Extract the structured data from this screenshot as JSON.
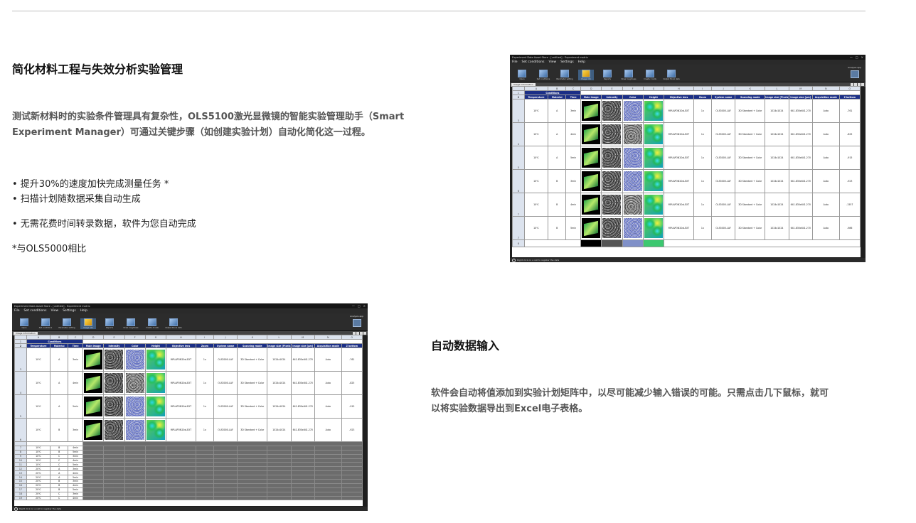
{
  "section1": {
    "title": "简化材料工程与失效分析实验管理",
    "paragraph_line1": "测试新材料时的实验条件管理具有复杂性，OLS5100激光显微镜的智能实验管理助手（Smart",
    "paragraph_line2": "Experiment Manager）可通过关键步骤（如创建实验计划）自动化简化这一过程。",
    "bullets": [
      "• 提升30%的速度加快完成测量任务 *",
      "• 扫描计划随数据采集自动生成",
      "• 无需花费时间转录数据，软件为您自动完成"
    ],
    "footnote": "*与OLS5000相比"
  },
  "section2": {
    "title": "自动数据输入",
    "paragraph_line1": "软件会自动将值添加到实验计划矩阵中，以尽可能减少输入错误的可能。只需点击几下鼠标，就可",
    "paragraph_line2": "以将实验数据导出到Excel电子表格。"
  },
  "app": {
    "title": "Experiment Data Asset Store - [untitled] - Experiment matrix",
    "menu": [
      "File",
      "Set conditions",
      "View",
      "Settings",
      "Help"
    ],
    "window_controls": [
      "—",
      "□",
      "×"
    ],
    "toolbar": [
      {
        "label": "Open",
        "icon": "folder-icon"
      },
      {
        "label": "Set conditions",
        "icon": "conditions-icon"
      },
      {
        "label": "Parameter setting",
        "icon": "parameter-icon"
      },
      {
        "label": "Image info",
        "icon": "image-info-icon"
      },
      {
        "label": "Reports",
        "icon": "reports-icon"
      },
      {
        "label": "Draw roughness",
        "icon": "roughness-icon"
      },
      {
        "label": "Create 2 cells",
        "icon": "cells-icon"
      },
      {
        "label": "Output Excel data",
        "icon": "excel-icon"
      }
    ],
    "active_tool_index": 3,
    "analysis_label": "Analysis app",
    "panel_tab": "Image information",
    "col_letters": [
      "",
      "A",
      "B",
      "C",
      "D",
      "E",
      "F",
      "G",
      "H",
      "I",
      "J",
      "K",
      "L",
      "M",
      "N",
      "O"
    ],
    "conditions_label": "Conditions",
    "headers": [
      "Temperature",
      "Material",
      "Time",
      "Main image",
      "Intensity",
      "Color",
      "Height",
      "Objective lens",
      "Zoom",
      "System name",
      "Scanning mode",
      "Image size [Pixels]",
      "Image size [µm]",
      "Acquisition mode",
      "Z bottom"
    ],
    "status_text": "Right click on a cell to register the data"
  },
  "screenshot_top": {
    "rows": [
      {
        "num": "3",
        "temp": "10℃",
        "material": "A",
        "time": "3min",
        "lens": "MPLAPON20xLEXT",
        "zoom": "1x",
        "system": "OLS5000-LAF",
        "scan": "3D Standard + Color",
        "px": "1024x1024",
        "um": "641.830x641.270",
        "acq": "Auto",
        "zb": "-761"
      },
      {
        "num": "4",
        "temp": "10℃",
        "material": "A",
        "time": "4min",
        "lens": "MPLAPON20xLEXT",
        "zoom": "1x",
        "system": "OLS5000-LAF",
        "scan": "3D Standard + Color",
        "px": "1024x1024",
        "um": "641.830x641.270",
        "acq": "Auto",
        "zb": "-825"
      },
      {
        "num": "5",
        "temp": "10℃",
        "material": "A",
        "time": "5min",
        "lens": "MPLAPON20xLEXT",
        "zoom": "1x",
        "system": "OLS5000-LAF",
        "scan": "3D Standard + Color",
        "px": "1024x1024",
        "um": "641.830x641.270",
        "acq": "Auto",
        "zb": "-915"
      },
      {
        "num": "6",
        "temp": "10℃",
        "material": "B",
        "time": "3min",
        "lens": "MPLAPON20xLEXT",
        "zoom": "1x",
        "system": "OLS5000-LAF",
        "scan": "3D Standard + Color",
        "px": "1024x1024",
        "um": "641.830x641.270",
        "acq": "Auto",
        "zb": "-923"
      },
      {
        "num": "7",
        "temp": "10℃",
        "material": "B",
        "time": "4min",
        "lens": "MPLAPON20xLEXT",
        "zoom": "1x",
        "system": "OLS5000-LAF",
        "scan": "3D Standard + Color",
        "px": "1024x1024",
        "um": "641.830x641.270",
        "acq": "Auto",
        "zb": "-1557"
      },
      {
        "num": "7",
        "temp": "10℃",
        "material": "B",
        "time": "5min",
        "lens": "MPLAPON20xLEXT",
        "zoom": "1x",
        "system": "OLS5000-LAF",
        "scan": "3D Standard + Color",
        "px": "1024x1024",
        "um": "641.830x641.270",
        "acq": "Auto",
        "zb": "-986"
      }
    ],
    "last_row_num": "8"
  },
  "screenshot_bottom": {
    "rows": [
      {
        "num": "3",
        "temp": "10℃",
        "material": "A",
        "time": "3min",
        "lens": "MPLAPON20xLEXT",
        "zoom": "1x",
        "system": "OLS5000-LAF",
        "scan": "3D Standard + Color",
        "px": "1024x1024",
        "um": "641.830x641.270",
        "acq": "Auto",
        "zb": "-761"
      },
      {
        "num": "4",
        "temp": "10℃",
        "material": "A",
        "time": "4min",
        "lens": "MPLAPON20xLEXT",
        "zoom": "1x",
        "system": "OLS5000-LAF",
        "scan": "3D Standard + Color",
        "px": "1024x1024",
        "um": "641.830x641.270",
        "acq": "Auto",
        "zb": "-825"
      },
      {
        "num": "5",
        "temp": "10℃",
        "material": "A",
        "time": "5min",
        "lens": "MPLAPON20xLEXT",
        "zoom": "1x",
        "system": "OLS5000-LAF",
        "scan": "3D Standard + Color",
        "px": "1024x1024",
        "um": "641.830x641.270",
        "acq": "Auto",
        "zb": "-915"
      },
      {
        "num": "6",
        "temp": "10℃",
        "material": "B",
        "time": "3min",
        "lens": "MPLAPON20xLEXT",
        "zoom": "1x",
        "system": "OLS5000-LAF",
        "scan": "3D Standard + Color",
        "px": "1024x1024",
        "um": "641.830x641.270",
        "acq": "Auto",
        "zb": "-923"
      }
    ],
    "small_rows": [
      {
        "num": "7",
        "temp": "10℃",
        "material": "B",
        "time": "4min"
      },
      {
        "num": "8",
        "temp": "10℃",
        "material": "B",
        "time": "5min"
      },
      {
        "num": "9",
        "temp": "10℃",
        "material": "C",
        "time": "3min"
      },
      {
        "num": "10",
        "temp": "10℃",
        "material": "C",
        "time": "4min"
      },
      {
        "num": "11",
        "temp": "10℃",
        "material": "C",
        "time": "5min"
      },
      {
        "num": "12",
        "temp": "20℃",
        "material": "A",
        "time": "3min"
      },
      {
        "num": "13",
        "temp": "20℃",
        "material": "A",
        "time": "4min"
      },
      {
        "num": "14",
        "temp": "20℃",
        "material": "A",
        "time": "5min"
      },
      {
        "num": "15",
        "temp": "20℃",
        "material": "B",
        "time": "3min"
      },
      {
        "num": "16",
        "temp": "20℃",
        "material": "B",
        "time": "4min"
      },
      {
        "num": "17",
        "temp": "20℃",
        "material": "B",
        "time": "5min"
      },
      {
        "num": "18",
        "temp": "20℃",
        "material": "C",
        "time": "3min"
      },
      {
        "num": "19",
        "temp": "20℃",
        "material": "C",
        "time": "4min"
      }
    ]
  }
}
